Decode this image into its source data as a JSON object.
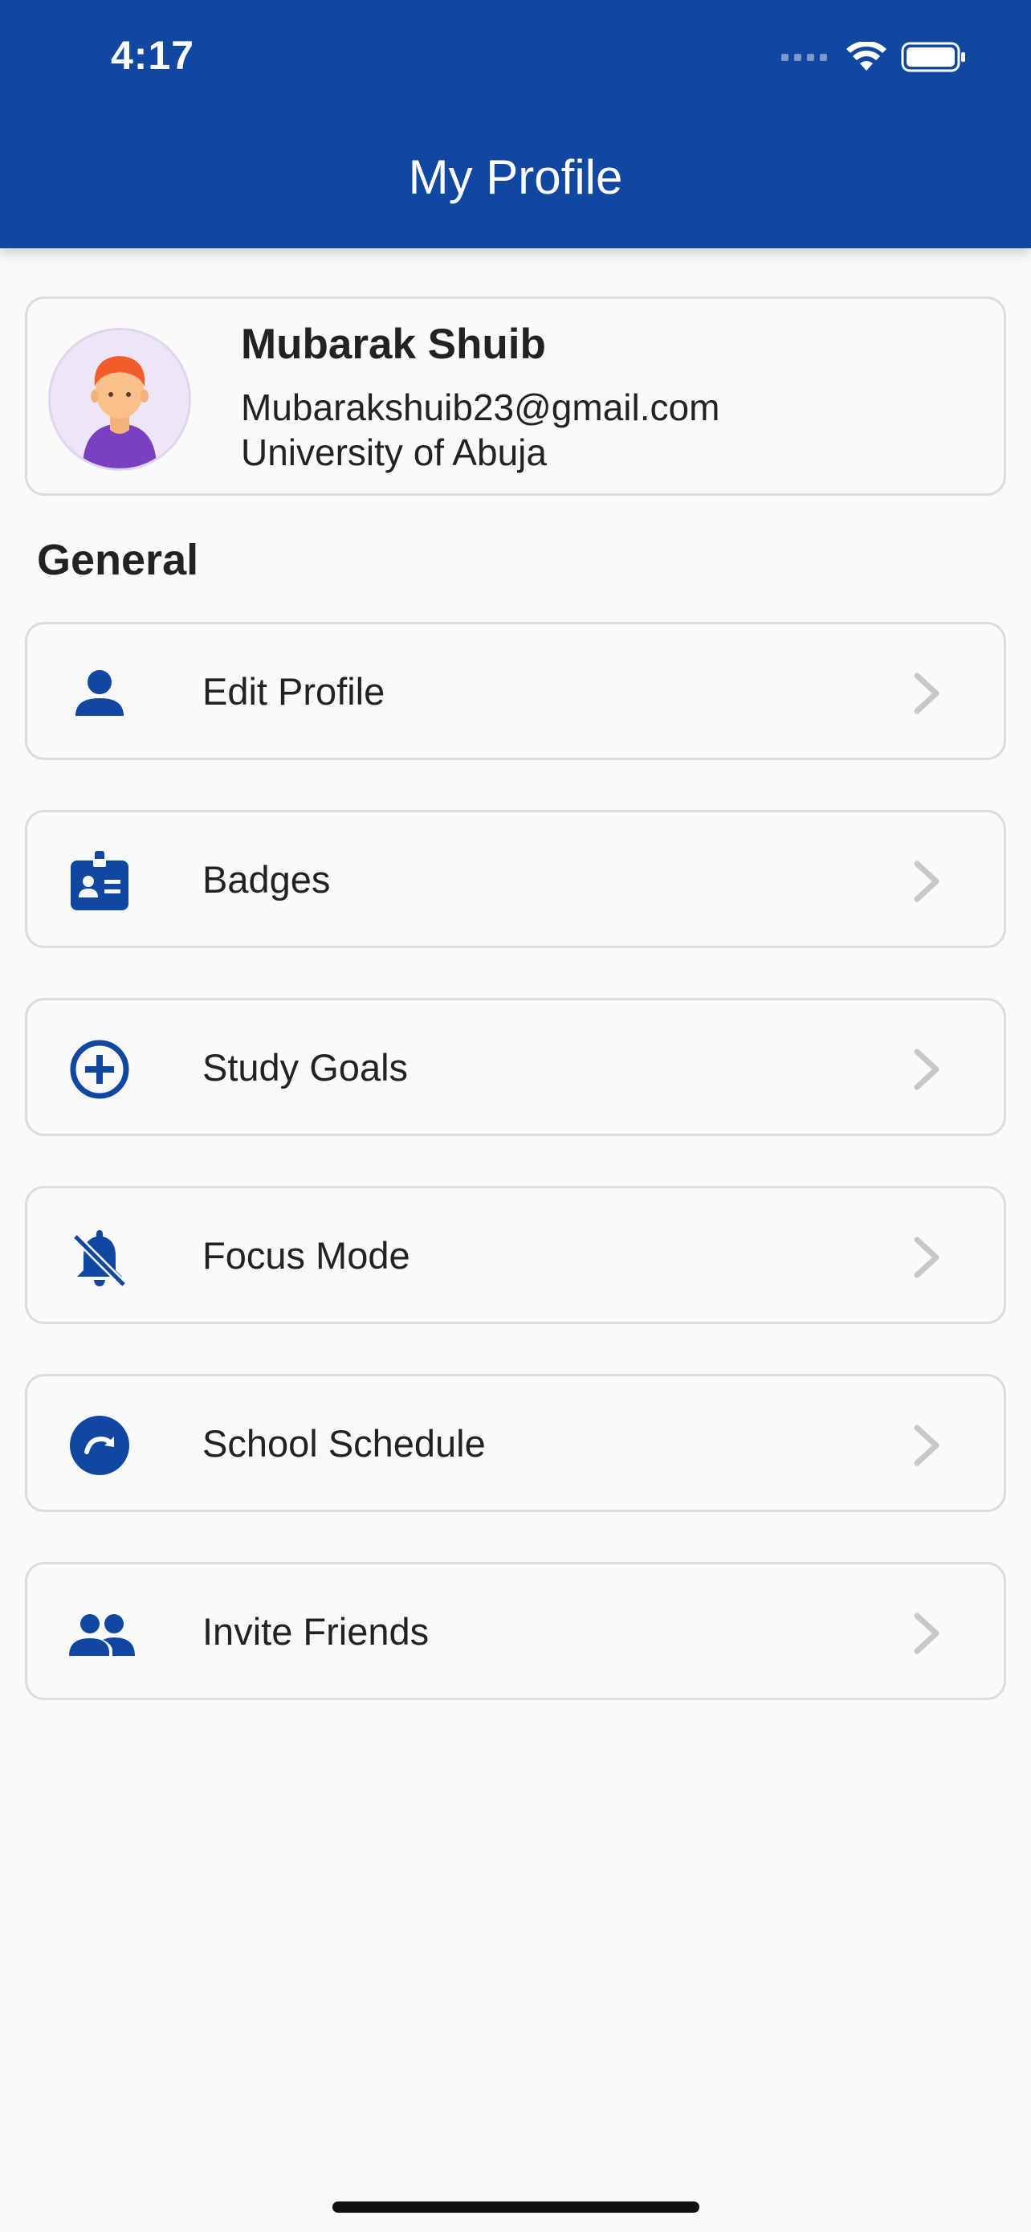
{
  "status_bar": {
    "time": "4:17"
  },
  "header": {
    "title": "My Profile"
  },
  "profile": {
    "name": "Mubarak Shuib",
    "email": "Mubarakshuib23@gmail.com",
    "school": "University of Abuja"
  },
  "section": {
    "title": "General"
  },
  "menu": {
    "items": [
      {
        "label": "Edit Profile",
        "icon": "person-icon"
      },
      {
        "label": "Badges",
        "icon": "badge-icon"
      },
      {
        "label": "Study Goals",
        "icon": "add-circle-icon"
      },
      {
        "label": "Focus Mode",
        "icon": "notifications-off-icon"
      },
      {
        "label": "School Schedule",
        "icon": "schedule-redo-icon"
      },
      {
        "label": "Invite Friends",
        "icon": "people-icon"
      }
    ]
  },
  "colors": {
    "primary": "#0f47a1",
    "background": "#fafafa",
    "border": "#dcdcdc",
    "chevron": "#c8c8c8",
    "text": "#222222"
  }
}
